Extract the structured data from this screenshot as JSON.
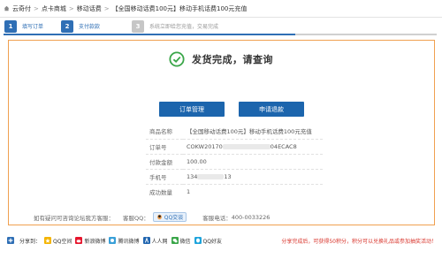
{
  "breadcrumb": {
    "items": [
      "云奇付",
      "点卡商城",
      "移动话费",
      "【全国移动话费100元】移动手机话费100元充值"
    ]
  },
  "steps": [
    {
      "num": "1",
      "label": "填写订单",
      "state": "active"
    },
    {
      "num": "2",
      "label": "支付款款",
      "state": "active"
    },
    {
      "num": "3",
      "label": "系统立即给您充值，交易完成",
      "state": "inactive"
    }
  ],
  "status": {
    "text": "发货完成，请查询",
    "icon": "check-circle-icon"
  },
  "buttons": {
    "orders": "订单管理",
    "refund": "申请退款"
  },
  "order_info": [
    {
      "key": "商品名称",
      "value": "【全国移动话费100元】移动手机话费100元充值"
    },
    {
      "key": "订单号",
      "value_prefix": "COKW20170",
      "value_suffix": "04ECAC8"
    },
    {
      "key": "付款金额",
      "value": "100.00"
    },
    {
      "key": "手机号",
      "value_prefix": "134",
      "value_suffix": "13"
    },
    {
      "key": "成功数量",
      "value": "1"
    }
  ],
  "contact": {
    "prompt": "如有疑问可咨询论坛我方客服：",
    "qq_label": "客服QQ：",
    "qq_button": "QQ交谈",
    "phone_label": "客服电话：",
    "phone": "400-0033226"
  },
  "share": {
    "label": "分享到：",
    "items": [
      "QQ空间",
      "新浪微博",
      "腾讯微博",
      "人人网",
      "微信",
      "QQ好友"
    ],
    "note": "分享完成后，可获得50积分，积分可以兑换礼品或参加抽奖活动！"
  },
  "colors": {
    "primary": "#1c65ad",
    "accent_orange": "#f0a050",
    "success_green": "#3aa649",
    "note_red": "#d9362d"
  }
}
